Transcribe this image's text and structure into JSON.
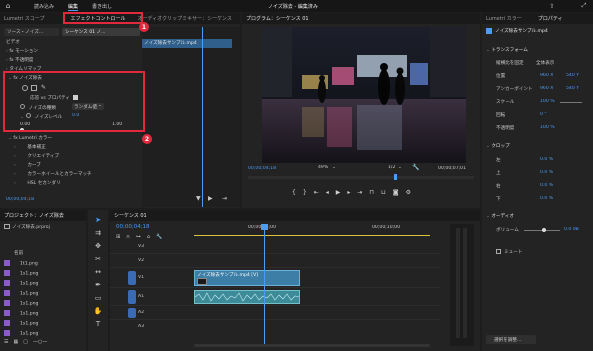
{
  "header": {
    "tabs": [
      {
        "label": "読み込み",
        "active": false
      },
      {
        "label": "編集",
        "active": true
      },
      {
        "label": "書き出し",
        "active": false
      }
    ],
    "title": "ノイズ除去 - 編集済み"
  },
  "left_panel": {
    "tabs": [
      "Lumetri スコープ",
      "エフェクトコントロール",
      "オーディオクリップミキサー：シーケンス"
    ],
    "source_label": "ソース・ノイズ...",
    "sequence_label": "シーケンス 01 ノ...",
    "clip_label": "ノイズ除去サンプル.mp4",
    "video_header": "ビデオ",
    "items_top": [
      "fx モーション",
      "fx 不透明度",
      "タイムリマップ"
    ],
    "noise_effect": {
      "title": "fx ノイズ除去",
      "apply_label": "応答 vs プロパティ",
      "type_label": "ノイズの種類",
      "type_value": "ランダム値",
      "level_label": "ノイズレベル",
      "level_value": "0.0",
      "scale_min": "0.00",
      "scale_max": "1.00"
    },
    "lumetri": {
      "title": "fx Lumetri カラー",
      "items": [
        "基本補正",
        "クリエイティブ",
        "カーブ",
        "カラーホイールとカラーマッチ",
        "HSL セカンダリ"
      ]
    },
    "timecode": "00;00;04;18"
  },
  "program": {
    "title": "プログラム：シーケンス 01",
    "timecode": "00;00;04;18",
    "zoom": "49%",
    "quality": "1/2",
    "duration": "00;00;07;01"
  },
  "right_panel": {
    "tabs": [
      "Lumetri カラー",
      "プロパティ"
    ],
    "clip_name": "ノイズ除去サンプル.mp4",
    "transform_title": "トランスフォーム",
    "lock_label": "縦横比を固定",
    "fill_label": "全体表示",
    "rows": [
      {
        "label": "位置",
        "v1": "960 X",
        "v2": "540 Y"
      },
      {
        "label": "アンカーポイント",
        "v1": "960 X",
        "v2": "540 Y"
      },
      {
        "label": "スケール",
        "v1": "100 %",
        "v2": ""
      },
      {
        "label": "回転",
        "v1": "0 °",
        "v2": ""
      },
      {
        "label": "不透明度",
        "v1": "100 %",
        "v2": ""
      }
    ],
    "crop_title": "クロップ",
    "crop_rows": [
      {
        "label": "左",
        "value": "0.0 %"
      },
      {
        "label": "上",
        "value": "0.0 %"
      },
      {
        "label": "右",
        "value": "0.0 %"
      },
      {
        "label": "下",
        "value": "0.0 %"
      }
    ],
    "audio_title": "オーディオ",
    "volume_label": "ボリューム",
    "volume_value": "0.0 dB",
    "mute_label": "ミュート",
    "search_button": "選択を調整..."
  },
  "project": {
    "title": "プロジェクト：ノイズ除去",
    "file": "ノイズ除去.prproj",
    "column": "名前",
    "items": [
      "1t1.png",
      "1s1.png",
      "1s1.png",
      "1s1.png",
      "1s1.png",
      "1s1.png",
      "1s1.png",
      "1s1.png"
    ]
  },
  "timeline": {
    "title": "シーケンス 01",
    "timecode": "00;00;04;18",
    "ruler": [
      "00;00;05;00",
      "00;00;10;00"
    ],
    "tracks": [
      "V3",
      "V2",
      "V1",
      "A1",
      "A2",
      "A3"
    ],
    "video_clip": "ノイズ除去サンプル.mp4 [V]"
  },
  "annotations": [
    "1",
    "2"
  ],
  "colors": {
    "accent": "#4a9cf4",
    "highlight": "#e02a3c",
    "video_clip": "#3c7ea6",
    "audio_clip": "#3d8a98"
  }
}
